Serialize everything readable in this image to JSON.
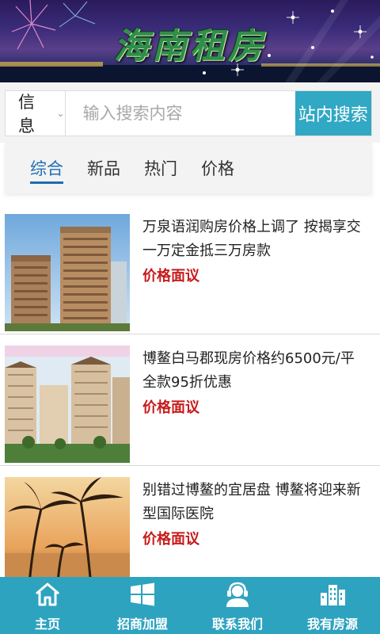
{
  "banner": {
    "title": "海南租房"
  },
  "search": {
    "type_label": "信息",
    "placeholder": "输入搜索内容",
    "button_label": "站内搜索"
  },
  "tabs": [
    {
      "label": "综合",
      "active": true
    },
    {
      "label": "新品",
      "active": false
    },
    {
      "label": "热门",
      "active": false
    },
    {
      "label": "价格",
      "active": false
    }
  ],
  "listings": [
    {
      "title": "万泉语润购房价格上调了 按揭享交一万定金抵三万房款",
      "price": "价格面议"
    },
    {
      "title": "博鳌白马郡现房价格约6500元/平 全款95折优惠",
      "price": "价格面议"
    },
    {
      "title": "别错过博鳌的宜居盘 博鳌将迎来新型国际医院",
      "price": "价格面议"
    }
  ],
  "bottom_nav": [
    {
      "label": "主页",
      "icon": "home-icon"
    },
    {
      "label": "招商加盟",
      "icon": "windows-icon"
    },
    {
      "label": "联系我们",
      "icon": "support-agent-icon"
    },
    {
      "label": "我有房源",
      "icon": "buildings-icon"
    }
  ],
  "colors": {
    "accent": "#31a8c4",
    "tab_active": "#1e6db4",
    "price": "#c81b1b",
    "nav_bg": "#2ea3bf"
  }
}
